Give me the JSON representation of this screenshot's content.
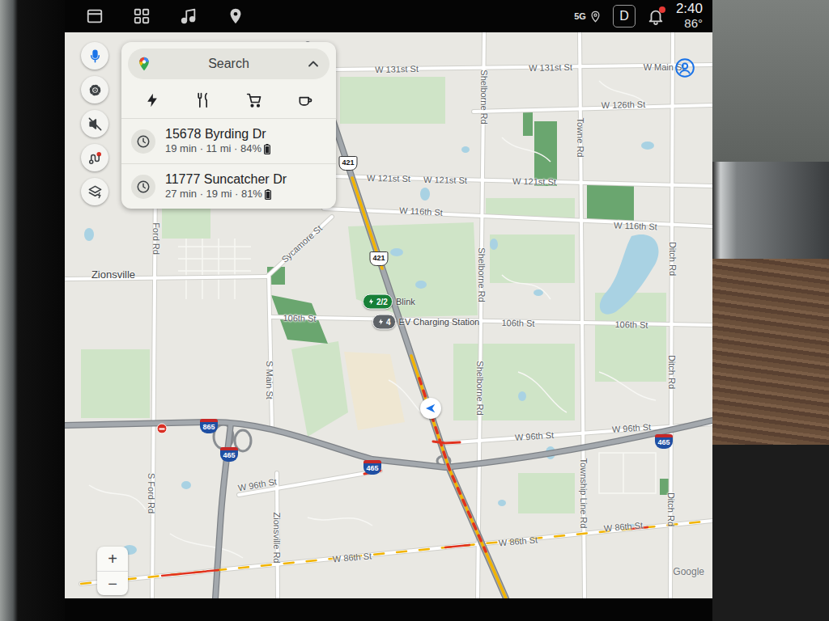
{
  "status_bar": {
    "network": "5G",
    "gear": "D",
    "time": "2:40",
    "temperature": "86°",
    "notification_unread": true
  },
  "search": {
    "label": "Search",
    "expanded": true
  },
  "recents": [
    {
      "title": "15678 Byrding Dr",
      "detail": "19 min · 11 mi · 84%"
    },
    {
      "title": "11777 Suncatcher Dr",
      "detail": "27 min · 19 mi · 81%"
    }
  ],
  "map_controls": {
    "voice_muted": true
  },
  "map": {
    "traffic_shown": true,
    "labels": [
      {
        "text": "W 131st St",
        "kind": "street"
      },
      {
        "text": "W 131st St",
        "kind": "street"
      },
      {
        "text": "W Main St",
        "kind": "street"
      },
      {
        "text": "W 126th St",
        "kind": "street"
      },
      {
        "text": "W 121st St",
        "kind": "street"
      },
      {
        "text": "W 121st St",
        "kind": "street"
      },
      {
        "text": "W 121st St",
        "kind": "street"
      },
      {
        "text": "W 116th St",
        "kind": "street"
      },
      {
        "text": "W 116th St",
        "kind": "street"
      },
      {
        "text": "Zionsville",
        "kind": "town"
      },
      {
        "text": "Sycamore St",
        "kind": "street"
      },
      {
        "text": "106th St",
        "kind": "street"
      },
      {
        "text": "106th St",
        "kind": "street"
      },
      {
        "text": "106th St",
        "kind": "street"
      },
      {
        "text": "W 96th St",
        "kind": "street"
      },
      {
        "text": "W 96th St",
        "kind": "street"
      },
      {
        "text": "W 96th St",
        "kind": "street"
      },
      {
        "text": "W 86th St",
        "kind": "street"
      },
      {
        "text": "W 86th St",
        "kind": "street"
      },
      {
        "text": "W 86th St",
        "kind": "street"
      },
      {
        "text": "Ford Rd",
        "kind": "street"
      },
      {
        "text": "S Ford Rd",
        "kind": "street"
      },
      {
        "text": "S Main St",
        "kind": "street"
      },
      {
        "text": "Zionsville Rd",
        "kind": "street"
      },
      {
        "text": "Shelborne Rd",
        "kind": "street"
      },
      {
        "text": "Shelborne Rd",
        "kind": "street"
      },
      {
        "text": "Shelborne Rd",
        "kind": "street"
      },
      {
        "text": "Towne Rd",
        "kind": "street"
      },
      {
        "text": "Township Line Rd",
        "kind": "street"
      },
      {
        "text": "Ditch Rd",
        "kind": "street"
      },
      {
        "text": "Ditch Rd",
        "kind": "street"
      },
      {
        "text": "Ditch Rd",
        "kind": "street"
      }
    ],
    "shields": [
      {
        "text": "421",
        "kind": "us"
      },
      {
        "text": "421",
        "kind": "us"
      },
      {
        "text": "865",
        "kind": "interstate"
      },
      {
        "text": "465",
        "kind": "interstate"
      },
      {
        "text": "465",
        "kind": "interstate"
      },
      {
        "text": "465",
        "kind": "interstate"
      }
    ],
    "markers": [
      {
        "count": "2/2",
        "label": "Blink",
        "color": "#188038"
      },
      {
        "count": "4",
        "label": "EV Charging Station",
        "color": "#5f6368"
      }
    ],
    "attribution": "Google"
  },
  "zoom": {
    "in": "+",
    "out": "−"
  }
}
